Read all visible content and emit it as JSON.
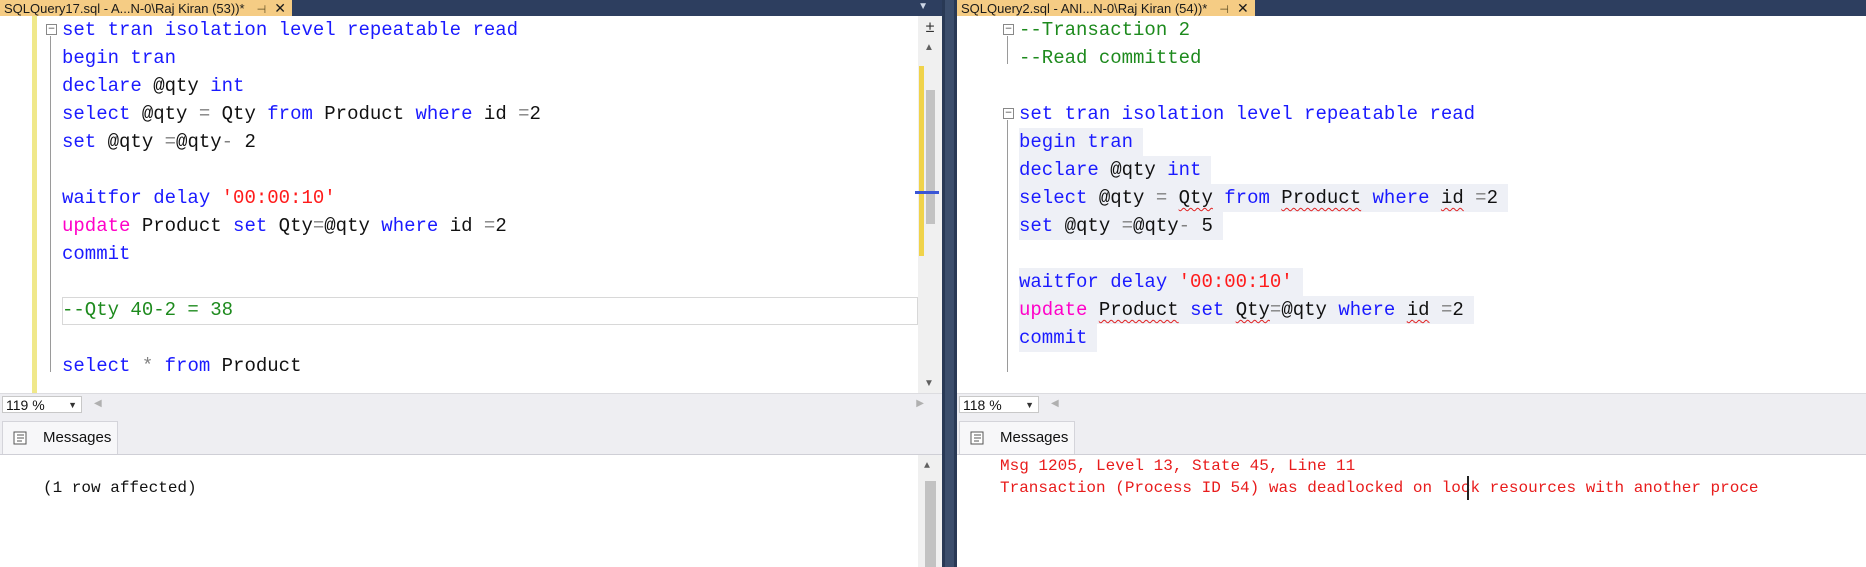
{
  "left": {
    "tab_title": "SQLQuery17.sql - A...N-0\\Raj Kiran (53))*",
    "zoom": "119 %",
    "messages_tab": "Messages",
    "code": [
      [
        {
          "t": "set tran isolation level repeatable read",
          "c": "kw"
        }
      ],
      [
        {
          "t": "begin tran",
          "c": "kw"
        }
      ],
      [
        {
          "t": "declare",
          "c": "kw"
        },
        {
          "t": " @qty ",
          "c": "txt"
        },
        {
          "t": "int",
          "c": "kw"
        }
      ],
      [
        {
          "t": "select",
          "c": "kw"
        },
        {
          "t": " @qty ",
          "c": "txt"
        },
        {
          "t": "=",
          "c": "gry"
        },
        {
          "t": " Qty ",
          "c": "txt"
        },
        {
          "t": "from",
          "c": "kw"
        },
        {
          "t": " Product ",
          "c": "txt"
        },
        {
          "t": "where",
          "c": "kw"
        },
        {
          "t": " id ",
          "c": "txt"
        },
        {
          "t": "=",
          "c": "gry"
        },
        {
          "t": "2",
          "c": "txt"
        }
      ],
      [
        {
          "t": "set",
          "c": "kw"
        },
        {
          "t": " @qty ",
          "c": "txt"
        },
        {
          "t": "=",
          "c": "gry"
        },
        {
          "t": "@qty",
          "c": "txt"
        },
        {
          "t": "-",
          "c": "gry"
        },
        {
          "t": " 2",
          "c": "txt"
        }
      ],
      [],
      [
        {
          "t": "waitfor delay ",
          "c": "kw"
        },
        {
          "t": "'00:00:10'",
          "c": "str"
        }
      ],
      [
        {
          "t": "update",
          "c": "pink"
        },
        {
          "t": " Product ",
          "c": "txt"
        },
        {
          "t": "set",
          "c": "kw"
        },
        {
          "t": " Qty",
          "c": "txt"
        },
        {
          "t": "=",
          "c": "gry"
        },
        {
          "t": "@qty ",
          "c": "txt"
        },
        {
          "t": "where",
          "c": "kw"
        },
        {
          "t": " id ",
          "c": "txt"
        },
        {
          "t": "=",
          "c": "gry"
        },
        {
          "t": "2",
          "c": "txt"
        }
      ],
      [
        {
          "t": "commit",
          "c": "kw"
        }
      ],
      [],
      [
        {
          "t": "--Qty 40-2 = 38",
          "c": "cmt"
        }
      ],
      [],
      [
        {
          "t": "select",
          "c": "kw"
        },
        {
          "t": " ",
          "c": "txt"
        },
        {
          "t": "*",
          "c": "gry"
        },
        {
          "t": " ",
          "c": "txt"
        },
        {
          "t": "from",
          "c": "kw"
        },
        {
          "t": " Product",
          "c": "txt"
        }
      ]
    ],
    "messages": [
      "(1 row affected)"
    ]
  },
  "right": {
    "tab_title": "SQLQuery2.sql - ANI...N-0\\Raj Kiran (54))*",
    "zoom": "118 %",
    "messages_tab": "Messages",
    "code": [
      [
        {
          "t": "--Transaction 2",
          "c": "cmt"
        }
      ],
      [
        {
          "t": "--Read committed",
          "c": "cmt"
        }
      ],
      [],
      [
        {
          "t": "set tran isolation level repeatable read",
          "c": "kw"
        }
      ],
      [
        {
          "t": "begin tran",
          "c": "kw"
        }
      ],
      [
        {
          "t": "declare",
          "c": "kw"
        },
        {
          "t": " @qty ",
          "c": "txt"
        },
        {
          "t": "int",
          "c": "kw"
        }
      ],
      [
        {
          "t": "select",
          "c": "kw"
        },
        {
          "t": " @qty ",
          "c": "txt"
        },
        {
          "t": "=",
          "c": "gry"
        },
        {
          "t": " ",
          "c": "txt"
        },
        {
          "t": "Qty",
          "c": "txt",
          "sq": true
        },
        {
          "t": " ",
          "c": "txt"
        },
        {
          "t": "from",
          "c": "kw"
        },
        {
          "t": " ",
          "c": "txt"
        },
        {
          "t": "Product",
          "c": "txt",
          "sq": true
        },
        {
          "t": " ",
          "c": "txt"
        },
        {
          "t": "where",
          "c": "kw"
        },
        {
          "t": " ",
          "c": "txt"
        },
        {
          "t": "id",
          "c": "txt",
          "sq": true
        },
        {
          "t": " ",
          "c": "txt"
        },
        {
          "t": "=",
          "c": "gry"
        },
        {
          "t": "2",
          "c": "txt"
        }
      ],
      [
        {
          "t": "set",
          "c": "kw"
        },
        {
          "t": " @qty ",
          "c": "txt"
        },
        {
          "t": "=",
          "c": "gry"
        },
        {
          "t": "@qty",
          "c": "txt"
        },
        {
          "t": "-",
          "c": "gry"
        },
        {
          "t": " 5",
          "c": "txt"
        }
      ],
      [],
      [
        {
          "t": "waitfor delay ",
          "c": "kw"
        },
        {
          "t": "'00:00:10'",
          "c": "str"
        }
      ],
      [
        {
          "t": "update",
          "c": "pink"
        },
        {
          "t": " ",
          "c": "txt"
        },
        {
          "t": "Product",
          "c": "txt",
          "sq": true
        },
        {
          "t": " ",
          "c": "txt"
        },
        {
          "t": "set",
          "c": "kw"
        },
        {
          "t": " ",
          "c": "txt"
        },
        {
          "t": "Qty",
          "c": "txt",
          "sq": true
        },
        {
          "t": "=",
          "c": "gry"
        },
        {
          "t": "@qty ",
          "c": "txt"
        },
        {
          "t": "where",
          "c": "kw"
        },
        {
          "t": " ",
          "c": "txt"
        },
        {
          "t": "id",
          "c": "txt",
          "sq": true
        },
        {
          "t": " ",
          "c": "txt"
        },
        {
          "t": "=",
          "c": "gry"
        },
        {
          "t": "2",
          "c": "txt"
        }
      ],
      [
        {
          "t": "commit",
          "c": "kw"
        }
      ]
    ],
    "messages": [
      "Msg 1205, Level 13, State 45, Line 11",
      "Transaction (Process ID 54) was deadlocked on lock resources with another proce"
    ]
  }
}
